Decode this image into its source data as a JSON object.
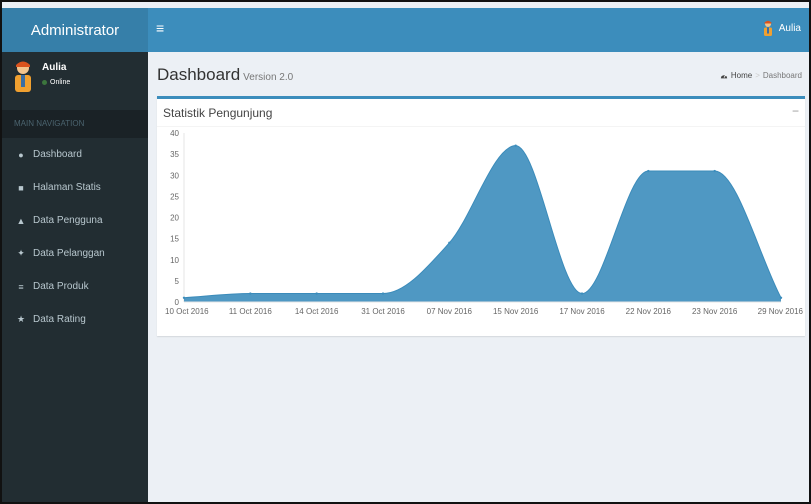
{
  "app": {
    "brand": "Administrator",
    "toggle_glyph": "≡",
    "top_user": "Aulia"
  },
  "sidebar": {
    "user_name": "Aulia",
    "user_status": "Online",
    "nav_header": "MAIN NAVIGATION",
    "items": [
      {
        "label": "Dashboard",
        "icon": "dashboard-icon",
        "glyph": "●"
      },
      {
        "label": "Halaman Statis",
        "icon": "book-icon",
        "glyph": "■"
      },
      {
        "label": "Data Pengguna",
        "icon": "user-icon",
        "glyph": "▲"
      },
      {
        "label": "Data Pelanggan",
        "icon": "users-icon",
        "glyph": "✦"
      },
      {
        "label": "Data Produk",
        "icon": "list-icon",
        "glyph": "≡"
      },
      {
        "label": "Data Rating",
        "icon": "star-icon",
        "glyph": "★"
      }
    ]
  },
  "content": {
    "title": "Dashboard",
    "subtitle": "Version 2.0",
    "breadcrumb": {
      "home": "Home",
      "separator": ">",
      "current": "Dashboard"
    },
    "box_title": "Statistik Pengunjung",
    "collapse_label": "−"
  },
  "colors": {
    "accent": "#3c8dbc",
    "brand_bg": "#367fa9",
    "sidebar_bg": "#222d32",
    "area_fill": "#3c8dbc"
  },
  "chart_data": {
    "type": "area",
    "title": "",
    "xlabel": "",
    "ylabel": "",
    "categories": [
      "10 Oct 2016",
      "11 Oct 2016",
      "14 Oct 2016",
      "31 Oct 2016",
      "07 Nov 2016",
      "15 Nov 2016",
      "17 Nov 2016",
      "22 Nov 2016",
      "23 Nov 2016",
      "29 Nov 2016"
    ],
    "values": [
      1,
      2,
      2,
      2,
      14,
      37,
      2,
      31,
      31,
      1
    ],
    "yticks": [
      0,
      5,
      10,
      15,
      20,
      25,
      30,
      35,
      40
    ],
    "ylim": [
      0,
      40
    ],
    "grid": false,
    "color": "#3c8dbc"
  }
}
